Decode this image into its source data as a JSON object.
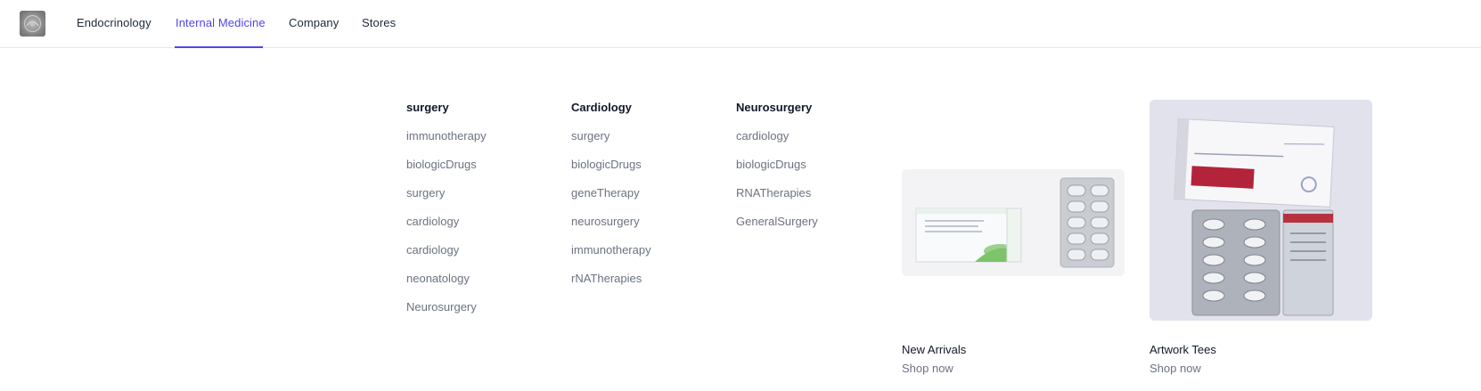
{
  "nav": {
    "items": [
      {
        "label": "Endocrinology"
      },
      {
        "label": "Internal Medicine",
        "active": true
      },
      {
        "label": "Company"
      },
      {
        "label": "Stores"
      }
    ]
  },
  "menu": {
    "columns": [
      {
        "title": "surgery",
        "links": [
          "immunotherapy",
          "biologicDrugs",
          "surgery",
          "cardiology",
          "cardiology",
          "neonatology",
          "Neurosurgery"
        ]
      },
      {
        "title": "Cardiology",
        "links": [
          "surgery",
          "biologicDrugs",
          "geneTherapy",
          "neurosurgery",
          "immunotherapy",
          "rNATherapies"
        ]
      },
      {
        "title": "Neurosurgery",
        "links": [
          "cardiology",
          "biologicDrugs",
          "RNATherapies",
          "GeneralSurgery"
        ]
      }
    ]
  },
  "featured": [
    {
      "title": "New Arrivals",
      "link": "Shop now"
    },
    {
      "title": "Artwork Tees",
      "link": "Shop now"
    }
  ],
  "colors": {
    "accent": "#4f46e5",
    "text": "#111827",
    "muted": "#6b7280",
    "border": "#e5e7eb"
  }
}
